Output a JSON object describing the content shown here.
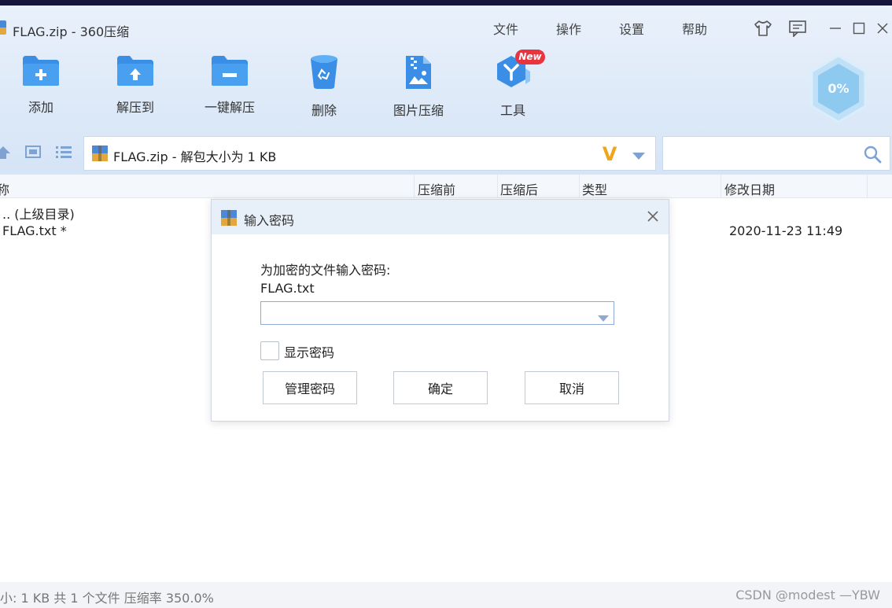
{
  "window": {
    "title": "FLAG.zip - 360压缩",
    "menu": [
      "文件",
      "操作",
      "设置",
      "帮助"
    ]
  },
  "toolbar": {
    "items": [
      "添加",
      "解压到",
      "一键解压",
      "删除",
      "图片压缩",
      "工具"
    ],
    "new_badge": "New",
    "meter_percent": "0%"
  },
  "pathbar": {
    "text": "FLAG.zip - 解包大小为 1 KB",
    "logo_letter": "V"
  },
  "columns": {
    "name": "称",
    "packed": "压缩前",
    "compressed": "压缩后",
    "type": "类型",
    "modified": "修改日期"
  },
  "files": [
    {
      "name": ".. (上级目录)",
      "date": ""
    },
    {
      "name": "FLAG.txt *",
      "date": "2020-11-23 11:49"
    }
  ],
  "statusbar": {
    "text": "小: 1 KB 共 1 个文件 压缩率 350.0%",
    "watermark": "CSDN @modest —YBW"
  },
  "dialog": {
    "title": "输入密码",
    "prompt": "为加密的文件输入密码:",
    "filename": "FLAG.txt",
    "password_value": "",
    "show_password_label": "显示密码",
    "show_password_checked": false,
    "buttons": {
      "manage": "管理密码",
      "ok": "确定",
      "cancel": "取消"
    }
  },
  "colors": {
    "accent": "#3a8ee6",
    "header_bg": "#d5e4f6",
    "badge": "#e8343f",
    "logo_v": "#f2a41b"
  }
}
